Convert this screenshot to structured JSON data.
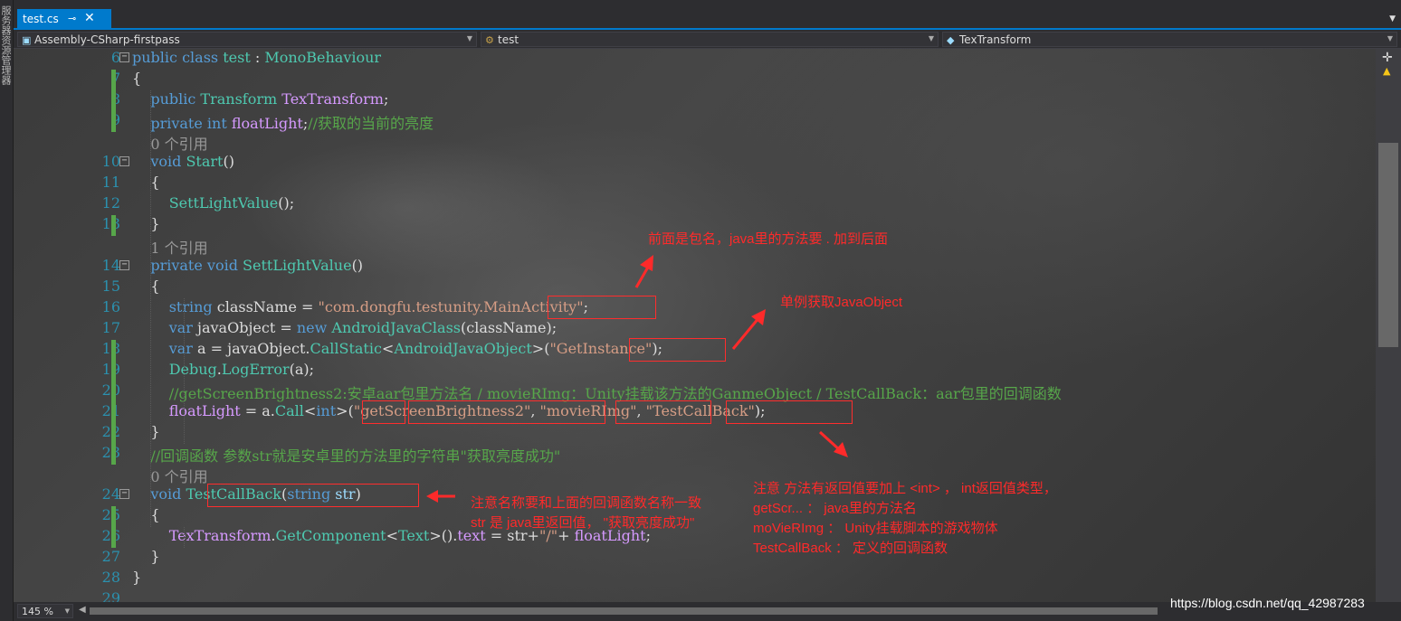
{
  "app": {
    "side_strip": "服务器资源管理器"
  },
  "tabs": [
    {
      "label": "test.cs",
      "pin": "⊸",
      "close": "✕"
    }
  ],
  "navbar": {
    "project": "Assembly-CSharp-firstpass",
    "class": "test",
    "member": "TexTransform"
  },
  "code_lines": [
    {
      "n": "6",
      "parts": [
        [
          "kw",
          "public class "
        ],
        [
          "ty",
          "test"
        ],
        [
          "pl",
          " : "
        ],
        [
          "ty",
          "MonoBehaviour"
        ]
      ]
    },
    {
      "n": "7",
      "parts": [
        [
          "pl",
          "{"
        ]
      ]
    },
    {
      "n": "8",
      "parts": [
        [
          "kw",
          "    public "
        ],
        [
          "ty",
          "Transform "
        ],
        [
          "fld",
          "TexTransform"
        ],
        [
          "pl",
          ";"
        ]
      ]
    },
    {
      "n": "9",
      "parts": [
        [
          "kw",
          "    private int "
        ],
        [
          "fld",
          "floatLight"
        ],
        [
          "pl",
          ";"
        ],
        [
          "cm",
          "//获取的当前的亮度"
        ]
      ]
    },
    {
      "n": "",
      "parts": [
        [
          "ref",
          "    0 个引用"
        ]
      ]
    },
    {
      "n": "10",
      "parts": [
        [
          "kw",
          "    void "
        ],
        [
          "fn",
          "Start"
        ],
        [
          "pl",
          "()"
        ]
      ]
    },
    {
      "n": "11",
      "parts": [
        [
          "pl",
          "    {"
        ]
      ]
    },
    {
      "n": "12",
      "parts": [
        [
          "fn",
          "        SettLightValue"
        ],
        [
          "pl",
          "();"
        ]
      ]
    },
    {
      "n": "13",
      "parts": [
        [
          "pl",
          "    }"
        ]
      ]
    },
    {
      "n": "",
      "parts": [
        [
          "ref",
          "    1 个引用"
        ]
      ]
    },
    {
      "n": "14",
      "parts": [
        [
          "kw",
          "    private void "
        ],
        [
          "fn",
          "SettLightValue"
        ],
        [
          "pl",
          "()"
        ]
      ]
    },
    {
      "n": "15",
      "parts": [
        [
          "pl",
          "    {"
        ]
      ]
    },
    {
      "n": "16",
      "parts": [
        [
          "kw",
          "        string "
        ],
        [
          "pl",
          "className = "
        ],
        [
          "str",
          "\"com.dongfu.testunity.MainActivity\""
        ],
        [
          "pl",
          ";"
        ]
      ]
    },
    {
      "n": "17",
      "parts": [
        [
          "kw",
          "        var "
        ],
        [
          "pl",
          "javaObject = "
        ],
        [
          "kw",
          "new "
        ],
        [
          "ty",
          "AndroidJavaClass"
        ],
        [
          "pl",
          "(className);"
        ]
      ]
    },
    {
      "n": "18",
      "parts": [
        [
          "kw",
          "        var "
        ],
        [
          "pl",
          "a = javaObject."
        ],
        [
          "fn",
          "CallStatic"
        ],
        [
          "pl",
          "<"
        ],
        [
          "ty",
          "AndroidJavaObject"
        ],
        [
          "pl",
          ">("
        ],
        [
          "str",
          "\"GetInstance\""
        ],
        [
          "pl",
          ");"
        ]
      ]
    },
    {
      "n": "19",
      "parts": [
        [
          "ty",
          "        Debug"
        ],
        [
          "pl",
          "."
        ],
        [
          "fn",
          "LogError"
        ],
        [
          "pl",
          "(a);"
        ]
      ]
    },
    {
      "n": "20",
      "parts": [
        [
          "cm",
          "        //getScreenBrightness2:安卓aar包里方法名 / movieRImg：Unity挂载该方法的GanmeObject / TestCallBack：aar包里的回调函数"
        ]
      ]
    },
    {
      "n": "21",
      "parts": [
        [
          "fld",
          "        floatLight"
        ],
        [
          "pl",
          " = a."
        ],
        [
          "fn",
          "Call"
        ],
        [
          "pl",
          "<"
        ],
        [
          "kw",
          "int"
        ],
        [
          "pl",
          ">("
        ],
        [
          "str",
          "\"getScreenBrightness2\""
        ],
        [
          "pl",
          ", "
        ],
        [
          "str",
          "\"movieRImg\""
        ],
        [
          "pl",
          ", "
        ],
        [
          "str",
          "\"TestCallBack\""
        ],
        [
          "pl",
          ");"
        ]
      ]
    },
    {
      "n": "22",
      "parts": [
        [
          "pl",
          "    }"
        ]
      ]
    },
    {
      "n": "23",
      "parts": [
        [
          "cm",
          "    //回调函数 参数str就是安卓里的方法里的字符串\"获取亮度成功\""
        ]
      ]
    },
    {
      "n": "",
      "parts": [
        [
          "ref",
          "    0 个引用"
        ]
      ]
    },
    {
      "n": "24",
      "parts": [
        [
          "kw",
          "    void "
        ],
        [
          "fn",
          "TestCallBack"
        ],
        [
          "pl",
          "("
        ],
        [
          "kw",
          "string "
        ],
        [
          "prm",
          "str"
        ],
        [
          "pl",
          ")"
        ]
      ]
    },
    {
      "n": "25",
      "parts": [
        [
          "pl",
          "    {"
        ]
      ]
    },
    {
      "n": "26",
      "parts": [
        [
          "fld",
          "        TexTransform"
        ],
        [
          "pl",
          "."
        ],
        [
          "fn",
          "GetComponent"
        ],
        [
          "pl",
          "<"
        ],
        [
          "ty",
          "Text"
        ],
        [
          "pl",
          ">()."
        ],
        [
          "fld",
          "text"
        ],
        [
          "pl",
          " = str+"
        ],
        [
          "str",
          "\"/\""
        ],
        [
          "pl",
          "+ "
        ],
        [
          "fld",
          "floatLight"
        ],
        [
          "pl",
          ";"
        ]
      ]
    },
    {
      "n": "27",
      "parts": [
        [
          "pl",
          "    }"
        ]
      ]
    },
    {
      "n": "28",
      "parts": [
        [
          "pl",
          "}"
        ]
      ]
    },
    {
      "n": "29",
      "parts": []
    }
  ],
  "annotations": {
    "package": "前面是包名，java里的方法要 . 加到后面",
    "singleton": "单例获取JavaObject",
    "callback_1": "注意名称要和上面的回调函数名称一致",
    "callback_2": "str 是 java里返回值，  \"获取亮度成功\"",
    "call_1": "注意 方法有返回值要加上 <int> ， int返回值类型，",
    "call_2": " getScr... ：  java里的方法名",
    "call_3": "moVieRImg   ：  Unity挂载脚本的游戏物体",
    "call_4": "TestCallBack   ：   定义的回调函数"
  },
  "status": {
    "zoom": "145 %"
  },
  "watermark": "https://blog.csdn.net/qq_42987283",
  "colors": {
    "accent": "#007acc",
    "annotation": "#ff2a2a",
    "keyword": "#569cd6",
    "type": "#4ec9b0",
    "comment": "#57a64a",
    "string": "#d69d85"
  }
}
